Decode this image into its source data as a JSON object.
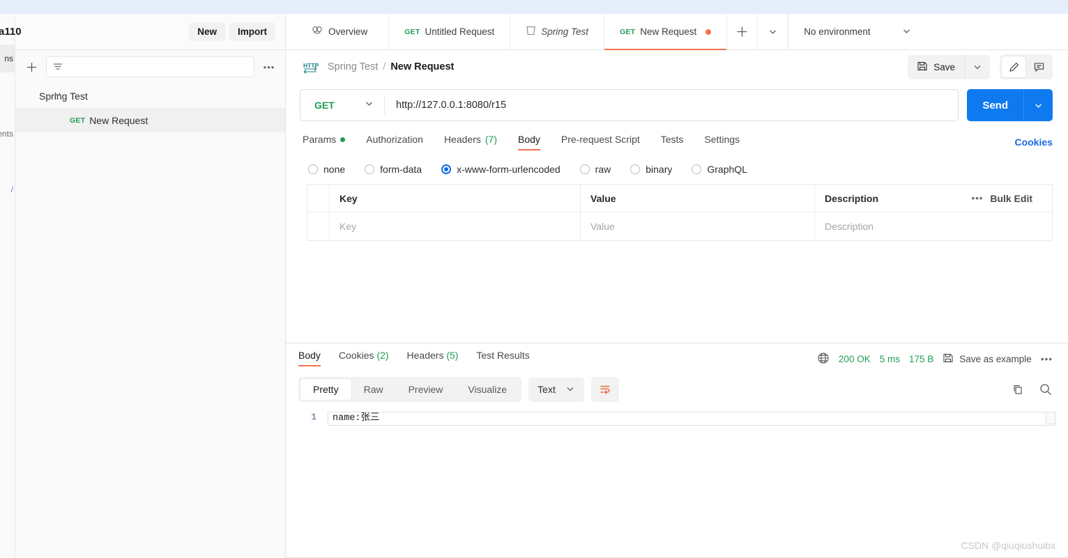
{
  "top_banner": {
    "clipped_text": "partially cut off browser/app chrome"
  },
  "rail": {
    "items": [
      {
        "label": "ns",
        "name": "collections",
        "selected": true
      },
      {
        "label": "ents",
        "name": "environments",
        "selected": false
      },
      {
        "label": "/",
        "name": "mock",
        "selected": false
      }
    ]
  },
  "sidebar": {
    "workspace_name": "a110",
    "new_label": "New",
    "import_label": "Import",
    "filter_placeholder": "",
    "add_icon": "plus-icon",
    "filter_icon": "filter-icon",
    "more_icon": "ellipsis-icon",
    "tree": [
      {
        "label": "Spring Test",
        "type": "collection",
        "expanded": true
      },
      {
        "method": "GET",
        "label": "New Request",
        "type": "request",
        "selected": true
      }
    ]
  },
  "tabs": {
    "items": [
      {
        "label": "Overview",
        "icon": "overview-icon",
        "method": "",
        "active": false,
        "italic": false,
        "dirty": false
      },
      {
        "label": "Untitled Request",
        "icon": "",
        "method": "GET",
        "active": false,
        "italic": false,
        "dirty": false
      },
      {
        "label": "Spring Test",
        "icon": "collection-icon",
        "method": "",
        "active": false,
        "italic": true,
        "dirty": false
      },
      {
        "label": "New Request",
        "icon": "",
        "method": "GET",
        "active": true,
        "italic": false,
        "dirty": true
      }
    ],
    "add_icon": "plus-icon",
    "list_icon": "chevron-down-icon",
    "environment": {
      "label": "No environment",
      "caret_icon": "chevron-down-icon"
    }
  },
  "request_header": {
    "protocol_icon": "http-icon",
    "breadcrumb_collection": "Spring Test",
    "breadcrumb_sep": "/",
    "breadcrumb_request": "New Request",
    "save_label": "Save",
    "save_icon": "floppy-disk-icon",
    "save_caret_icon": "chevron-down-icon",
    "edit_icon": "pencil-icon",
    "comment_icon": "comment-icon"
  },
  "url_bar": {
    "method": "GET",
    "method_caret_icon": "chevron-down-icon",
    "url": "http://127.0.0.1:8080/r15",
    "send_label": "Send",
    "send_caret_icon": "chevron-down-icon",
    "accent_blue": "#0f7aef"
  },
  "request_tabs": {
    "items": [
      {
        "label": "Params",
        "badge": "",
        "dot": true,
        "active": false
      },
      {
        "label": "Authorization",
        "badge": "",
        "dot": false,
        "active": false
      },
      {
        "label": "Headers",
        "badge": "(7)",
        "dot": false,
        "active": false
      },
      {
        "label": "Body",
        "badge": "",
        "dot": false,
        "active": true
      },
      {
        "label": "Pre-request Script",
        "badge": "",
        "dot": false,
        "active": false
      },
      {
        "label": "Tests",
        "badge": "",
        "dot": false,
        "active": false
      },
      {
        "label": "Settings",
        "badge": "",
        "dot": false,
        "active": false
      }
    ],
    "cookies_link": "Cookies",
    "accent_orange": "#f2734c"
  },
  "body_type": {
    "options": [
      {
        "label": "none",
        "selected": false
      },
      {
        "label": "form-data",
        "selected": false
      },
      {
        "label": "x-www-form-urlencoded",
        "selected": true
      },
      {
        "label": "raw",
        "selected": false
      },
      {
        "label": "binary",
        "selected": false
      },
      {
        "label": "GraphQL",
        "selected": false
      }
    ]
  },
  "kv_table": {
    "headers": {
      "key": "Key",
      "value": "Value",
      "description": "Description"
    },
    "more_icon": "ellipsis-icon",
    "bulk_edit_label": "Bulk Edit",
    "rows": [
      {
        "key": "Key",
        "value": "Value",
        "description": "Description",
        "placeholder": true
      }
    ]
  },
  "response": {
    "tabs": [
      {
        "label": "Body",
        "badge": "",
        "active": true
      },
      {
        "label": "Cookies",
        "badge": "(2)",
        "active": false
      },
      {
        "label": "Headers",
        "badge": "(5)",
        "active": false
      },
      {
        "label": "Test Results",
        "badge": "",
        "active": false
      }
    ],
    "globe_icon": "globe-icon",
    "status": "200 OK",
    "time": "5 ms",
    "size": "175 B",
    "save_example_icon": "floppy-disk-icon",
    "save_example_label": "Save as example",
    "more_icon": "ellipsis-icon",
    "status_color": "#1f9d55",
    "view_modes": [
      {
        "label": "Pretty",
        "active": true
      },
      {
        "label": "Raw",
        "active": false
      },
      {
        "label": "Preview",
        "active": false
      },
      {
        "label": "Visualize",
        "active": false
      }
    ],
    "format": {
      "label": "Text",
      "caret_icon": "chevron-down-icon"
    },
    "wrap_icon": "word-wrap-icon",
    "copy_icon": "copy-icon",
    "search_icon": "search-icon",
    "body_lines": [
      {
        "number": "1",
        "text": "name:张三"
      }
    ]
  },
  "watermark": "CSDN @qiuqiushuibx"
}
